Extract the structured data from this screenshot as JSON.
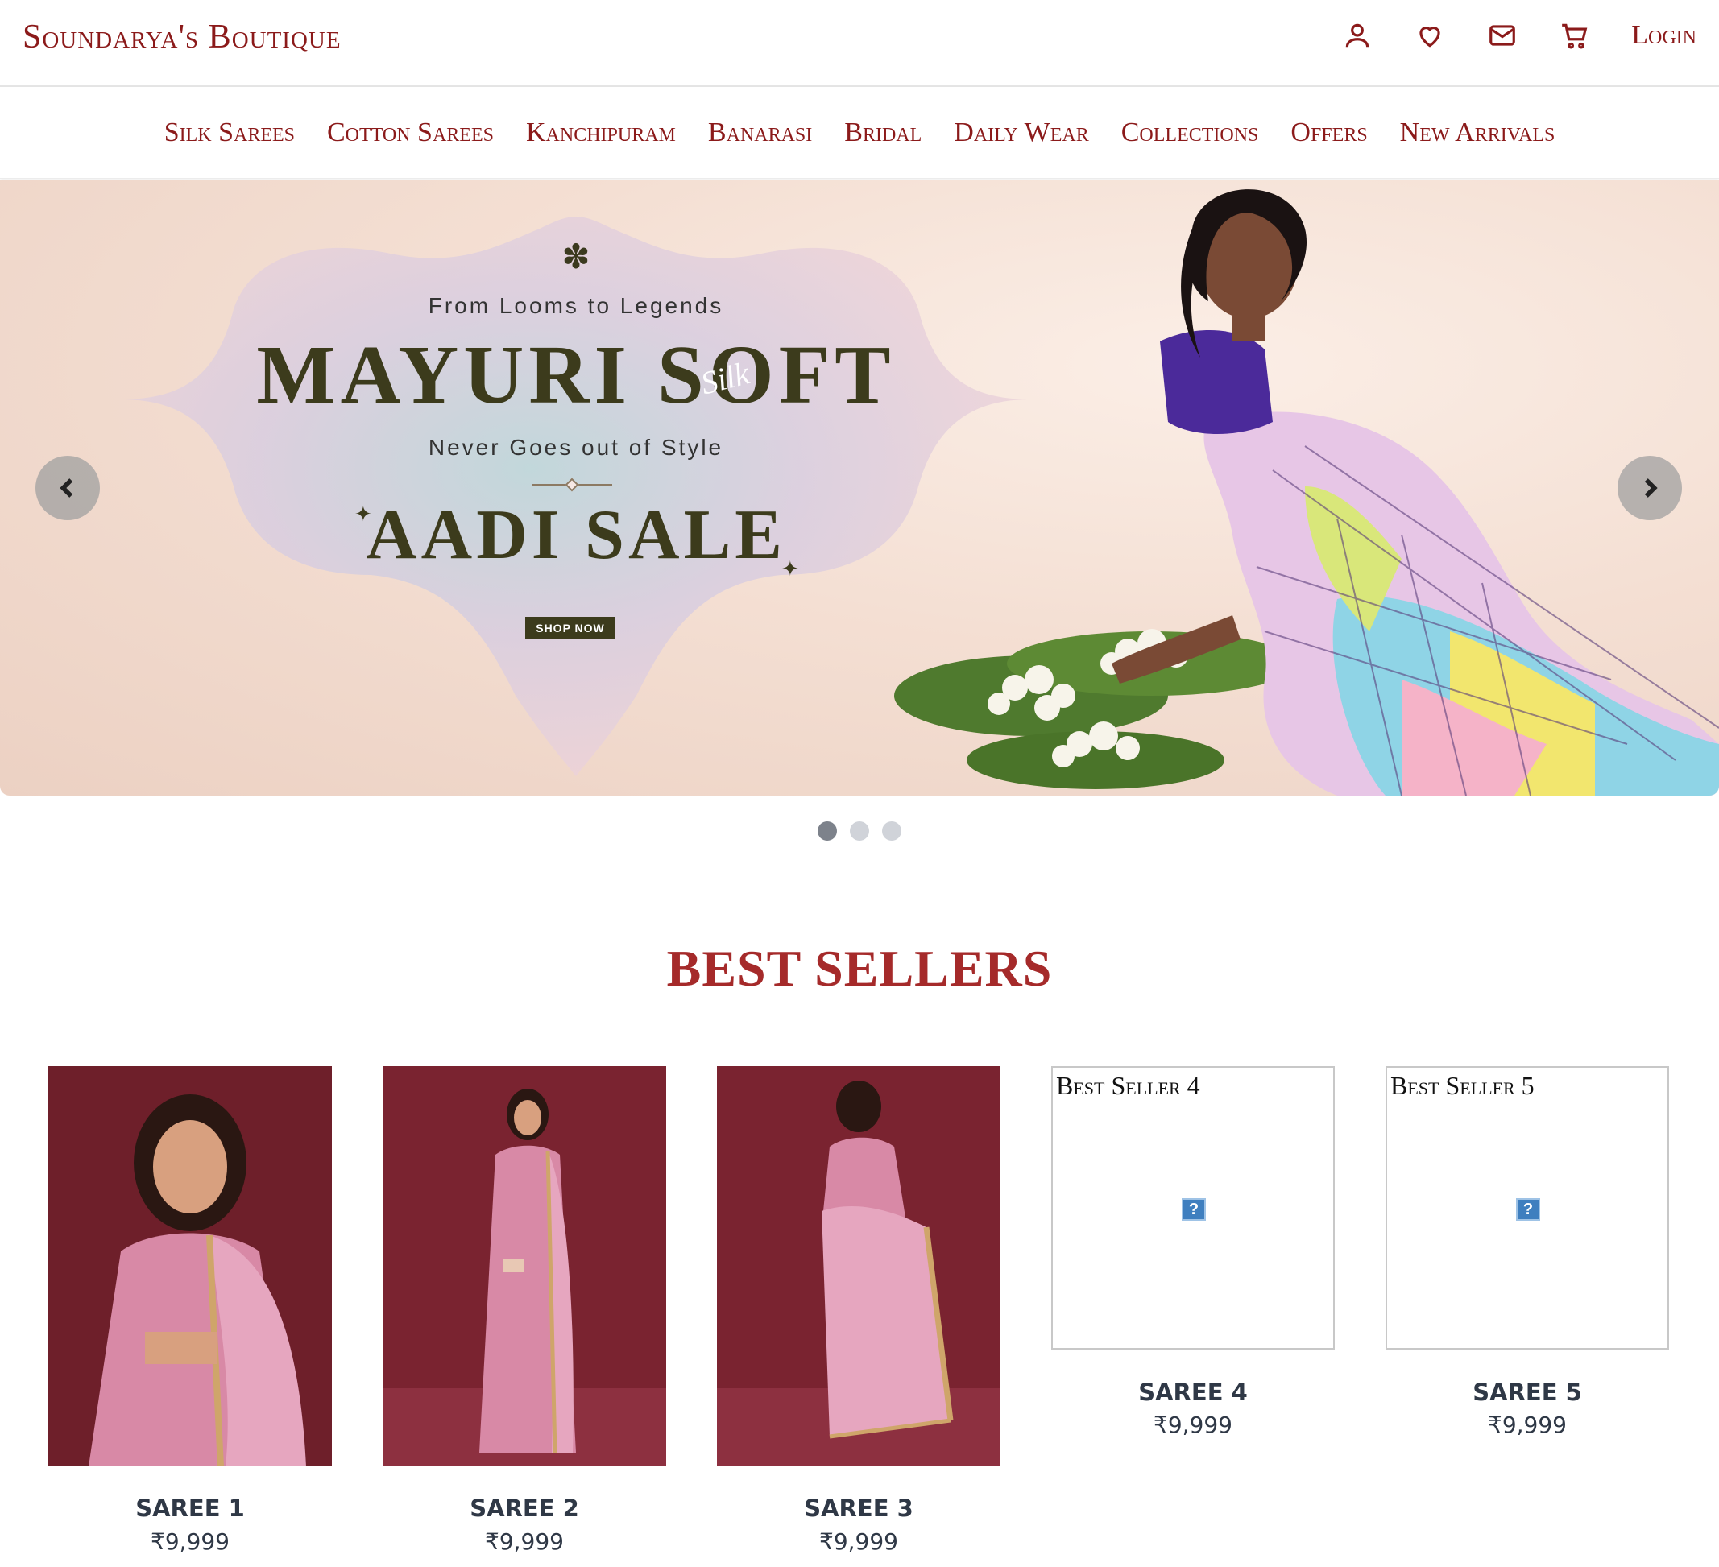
{
  "header": {
    "brand": "Soundarya's Boutique",
    "login_label": "Login",
    "icons": [
      "user-icon",
      "heart-icon",
      "mail-icon",
      "cart-icon"
    ]
  },
  "nav": {
    "items": [
      {
        "label": "Silk Sarees"
      },
      {
        "label": "Cotton Sarees"
      },
      {
        "label": "Kanchipuram"
      },
      {
        "label": "Banarasi"
      },
      {
        "label": "Bridal"
      },
      {
        "label": "Daily Wear"
      },
      {
        "label": "Collections"
      },
      {
        "label": "Offers"
      },
      {
        "label": "New Arrivals"
      }
    ]
  },
  "hero": {
    "tagline": "From Looms to Legends",
    "headline": "MAYURI SOFT",
    "headline_script": "Silk",
    "subline": "Never Goes out of Style",
    "sale": "AADI SALE",
    "cta": "SHOP NOW",
    "slides": 3,
    "active_slide": 1
  },
  "best_sellers": {
    "title": "BEST SELLERS",
    "products": [
      {
        "name": "SAREE 1",
        "price": "₹9,999",
        "image_alt": ""
      },
      {
        "name": "SAREE 2",
        "price": "₹9,999",
        "image_alt": ""
      },
      {
        "name": "SAREE 3",
        "price": "₹9,999",
        "image_alt": ""
      },
      {
        "name": "SAREE 4",
        "price": "₹9,999",
        "image_alt": "Best Seller 4"
      },
      {
        "name": "SAREE 5",
        "price": "₹9,999",
        "image_alt": "Best Seller 5"
      }
    ]
  },
  "colors": {
    "brand": "#8b1a1a",
    "section_title": "#a52a2a",
    "text_dark": "#2f3846",
    "hero_bg": "#f4dfd3"
  }
}
